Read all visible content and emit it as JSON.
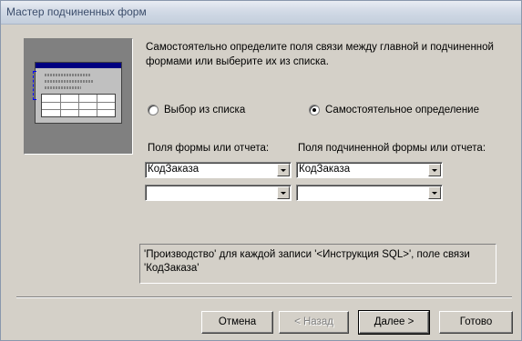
{
  "window": {
    "title": "Мастер подчиненных форм"
  },
  "description": "Самостоятельно определите поля связи между главной и подчиненной формами или выберите их из списка.",
  "radios": {
    "from_list": {
      "label": "Выбор из списка",
      "selected": false
    },
    "manual": {
      "label": "Самостоятельное определение",
      "selected": true
    }
  },
  "fields": {
    "main_label": "Поля формы или отчета:",
    "sub_label": "Поля подчиненной формы или отчета:",
    "main_values": [
      "КодЗаказа",
      ""
    ],
    "sub_values": [
      "КодЗаказа",
      ""
    ]
  },
  "status_text": "'Производство' для каждой записи '<Инструкция SQL>', поле связи 'КодЗаказа'",
  "buttons": {
    "cancel": "Отмена",
    "back": "< Назад",
    "next": "Далее >",
    "finish": "Готово"
  }
}
